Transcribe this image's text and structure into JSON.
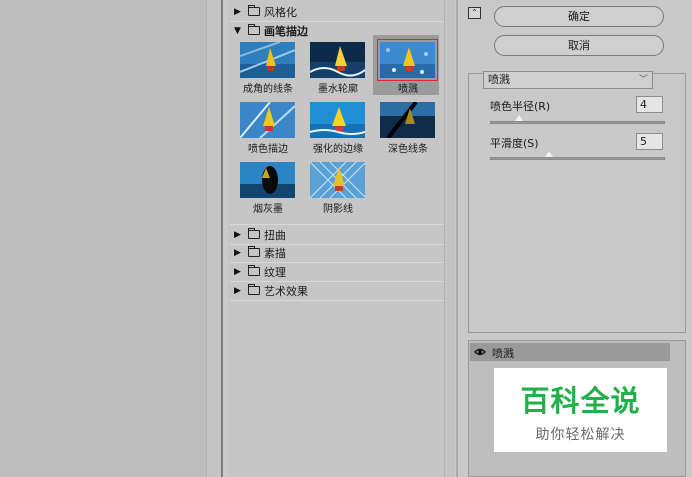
{
  "gallery": {
    "categories_top": [
      {
        "label": "风格化",
        "expanded": false
      },
      {
        "label": "画笔描边",
        "expanded": true
      }
    ],
    "thumbnails": [
      {
        "label": "成角的线条",
        "selected": false
      },
      {
        "label": "墨水轮廓",
        "selected": false
      },
      {
        "label": "喷溅",
        "selected": true
      },
      {
        "label": "喷色描边",
        "selected": false
      },
      {
        "label": "强化的边缘",
        "selected": false
      },
      {
        "label": "深色线条",
        "selected": false
      },
      {
        "label": "烟灰墨",
        "selected": false
      },
      {
        "label": "阴影线",
        "selected": false
      }
    ],
    "categories_bottom": [
      {
        "label": "扭曲"
      },
      {
        "label": "素描"
      },
      {
        "label": "纹理"
      },
      {
        "label": "艺术效果"
      }
    ]
  },
  "buttons": {
    "ok": "确定",
    "cancel": "取消"
  },
  "settings": {
    "filter_select": "喷溅",
    "params": [
      {
        "label": "喷色半径(R)",
        "value": "4",
        "level": 0.16
      },
      {
        "label": "平滑度(S)",
        "value": "5",
        "level": 0.33
      }
    ]
  },
  "layers": {
    "active": "喷溅"
  },
  "watermark": {
    "title": "百科全说",
    "subtitle": "助你轻松解决"
  },
  "colors": {
    "selection_outline": "#d92c2c",
    "watermark_green": "#21b04a"
  }
}
